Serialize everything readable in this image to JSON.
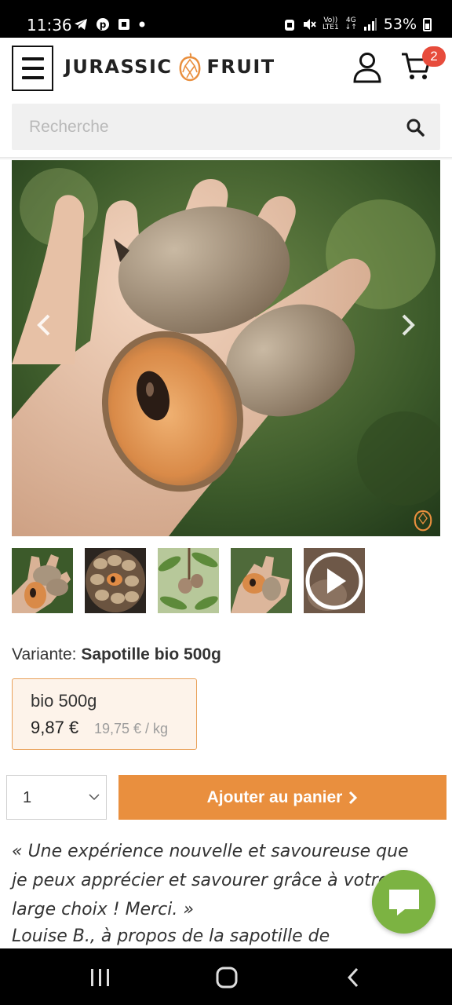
{
  "status_bar": {
    "time": "11:36",
    "network_top": "Vo))",
    "network_bottom": "LTE1",
    "network_type": "4G",
    "battery": "53%",
    "icons": [
      "telegram-icon",
      "pinterest-icon",
      "notification-icon",
      "dot-icon",
      "alarm-icon",
      "mute-icon",
      "signal-icon",
      "battery-icon"
    ]
  },
  "header": {
    "logo_left": "JURASSIC",
    "logo_right": "FRUIT",
    "cart_count": "2"
  },
  "search": {
    "placeholder": "Recherche"
  },
  "gallery": {
    "image_alt": "sapotilles dans une main",
    "thumbnails": [
      "sapotilles-main",
      "sapotilles-panier",
      "sapotillier-branche",
      "sapotilles-main-2",
      "video"
    ]
  },
  "variant": {
    "label": "Variante:",
    "selected": "Sapotille bio 500g",
    "option_name": "bio 500g",
    "option_price": "9,87 €",
    "option_price_per_kg": "19,75 € / kg"
  },
  "cart_form": {
    "quantity": "1",
    "add_button": "Ajouter au panier"
  },
  "testimonial": {
    "quote": "« Une expérience nouvelle et savoureuse que je peux apprécier et savourer grâce à votre large choix ! Merci. »",
    "author": "Louise B., à propos de la sapotille de"
  },
  "colors": {
    "accent": "#e98f3e",
    "badge": "#e74c3c",
    "chat": "#7cb342",
    "variant_bg": "#fdf3ea"
  }
}
